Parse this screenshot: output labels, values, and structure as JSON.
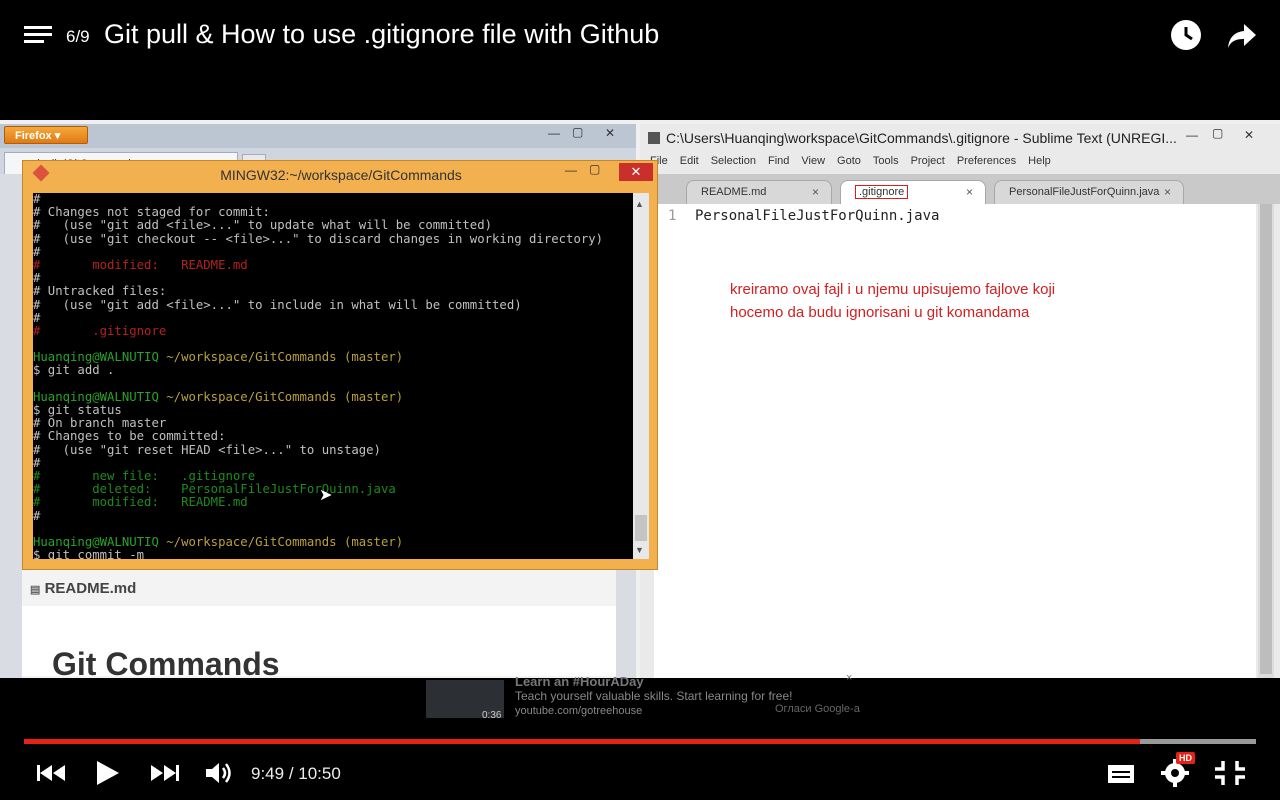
{
  "player": {
    "playlist_counter": "6/9",
    "title": "Git pull & How to use .gitignore file with Github",
    "time_current": "9:49",
    "time_separator": " / ",
    "time_total": "10:50",
    "progress_fraction": 0.906,
    "buffered_fraction": 0.905,
    "hd_label": "HD",
    "accent_color": "#e62117"
  },
  "firefox": {
    "menu_button": "Firefox",
    "tab_label": "quinnliu/GitCommands",
    "new_tab": "+",
    "readme_label": "README.md",
    "heading": "Git Commands"
  },
  "gitbash": {
    "title": "MINGW32:~/workspace/GitCommands",
    "lines": [
      {
        "t": "#",
        "c": ""
      },
      {
        "t": "# Changes not staged for commit:",
        "c": ""
      },
      {
        "t": "#   (use \"git add <file>...\" to update what will be committed)",
        "c": ""
      },
      {
        "t": "#   (use \"git checkout -- <file>...\" to discard changes in working directory)",
        "c": ""
      },
      {
        "t": "#",
        "c": ""
      },
      {
        "t": "#       modified:   README.md",
        "c": "red"
      },
      {
        "t": "#",
        "c": ""
      },
      {
        "t": "# Untracked files:",
        "c": ""
      },
      {
        "t": "#   (use \"git add <file>...\" to include in what will be committed)",
        "c": ""
      },
      {
        "t": "#",
        "c": ""
      },
      {
        "t": "#       .gitignore",
        "c": "red"
      },
      {
        "t": "",
        "c": ""
      },
      {
        "t": "Huanqing@WALNUTIQ ~/workspace/GitCommands (master)",
        "c": "prompt"
      },
      {
        "t": "$ git add .",
        "c": ""
      },
      {
        "t": "",
        "c": ""
      },
      {
        "t": "Huanqing@WALNUTIQ ~/workspace/GitCommands (master)",
        "c": "prompt"
      },
      {
        "t": "$ git status",
        "c": ""
      },
      {
        "t": "# On branch master",
        "c": ""
      },
      {
        "t": "# Changes to be committed:",
        "c": ""
      },
      {
        "t": "#   (use \"git reset HEAD <file>...\" to unstage)",
        "c": ""
      },
      {
        "t": "#",
        "c": ""
      },
      {
        "t": "#       new file:   .gitignore",
        "c": "green"
      },
      {
        "t": "#       deleted:    PersonalFileJustForQuinn.java",
        "c": "green"
      },
      {
        "t": "#       modified:   README.md",
        "c": "green"
      },
      {
        "t": "#",
        "c": ""
      },
      {
        "t": "",
        "c": ""
      },
      {
        "t": "Huanqing@WALNUTIQ ~/workspace/GitCommands (master)",
        "c": "prompt"
      },
      {
        "t": "$ git commit -m",
        "c": ""
      }
    ]
  },
  "sublime": {
    "title": "C:\\Users\\Huanqing\\workspace\\GitCommands\\.gitignore - Sublime Text (UNREGI...",
    "menu": [
      "File",
      "Edit",
      "Selection",
      "Find",
      "View",
      "Goto",
      "Tools",
      "Project",
      "Preferences",
      "Help"
    ],
    "tabs": [
      {
        "label": "README.md",
        "active": false
      },
      {
        "label": ".gitignore",
        "active": true
      },
      {
        "label": "PersonalFileJustForQuinn.java",
        "active": false
      }
    ],
    "line_number": "1",
    "line_text": "PersonalFileJustForQuinn.java",
    "annotation_line1": "kreiramo ovaj fajl i u njemu upisujemo fajlove koji",
    "annotation_line2": "hocemo da budu ignorisani u git komandama"
  },
  "ad": {
    "title": "Learn an #HourADay",
    "description": "Teach yourself valuable skills. Start learning for free!",
    "url": "youtube.com/gotreehouse",
    "duration": "0:36",
    "google_label": "Огласи Google-а"
  },
  "icons": {
    "playlist": "playlist-icon",
    "watch_later": "clock-icon",
    "share": "share-icon",
    "previous": "previous-icon",
    "play": "play-icon",
    "next": "next-icon",
    "volume": "volume-icon",
    "captions": "captions-icon",
    "settings": "gear-icon",
    "fullscreen_exit": "exit-fullscreen-icon"
  }
}
